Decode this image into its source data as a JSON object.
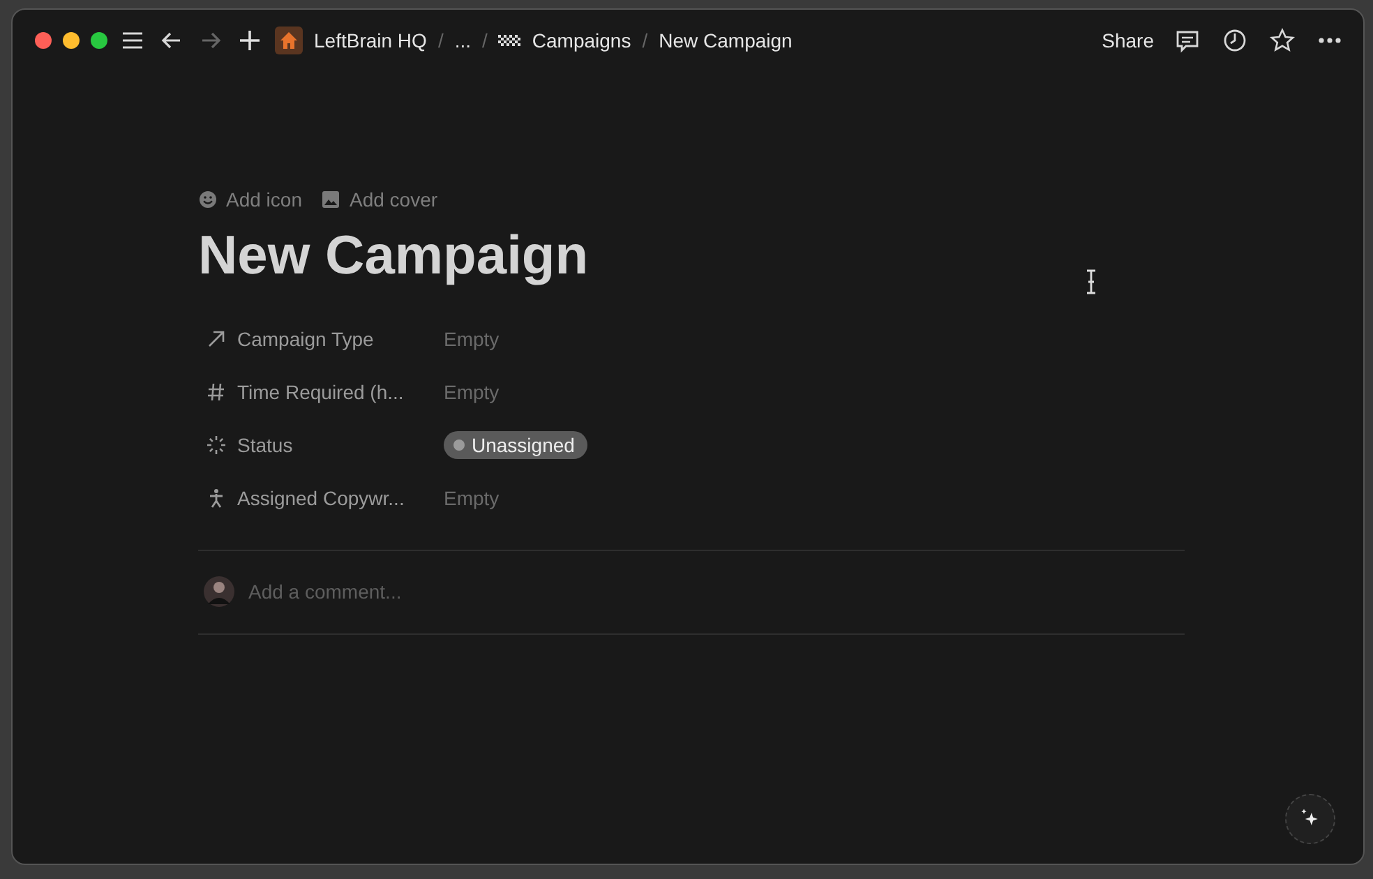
{
  "breadcrumbs": [
    {
      "label": "LeftBrain HQ",
      "kind": "home"
    },
    {
      "separator": "/",
      "label": "...",
      "kind": "plain"
    },
    {
      "separator": "/",
      "label": "Campaigns",
      "kind": "flag"
    },
    {
      "separator": "/",
      "label": "New Campaign",
      "kind": "plain"
    }
  ],
  "top_actions": {
    "share": "Share"
  },
  "page_actions": [
    "Add icon",
    "Add cover"
  ],
  "title": "New Campaign",
  "properties": [
    {
      "kind": "relation",
      "name": "Campaign Type",
      "value": "Empty"
    },
    {
      "kind": "number",
      "name": "Time Required (h...",
      "value": "Empty"
    },
    {
      "kind": "status",
      "name": "Status",
      "value": "Unassigned",
      "color": "#9b9b9b"
    },
    {
      "kind": "person",
      "name": "Assigned Copywr...",
      "value": "Empty"
    }
  ],
  "comment": {
    "placeholder": "Add a comment..."
  }
}
